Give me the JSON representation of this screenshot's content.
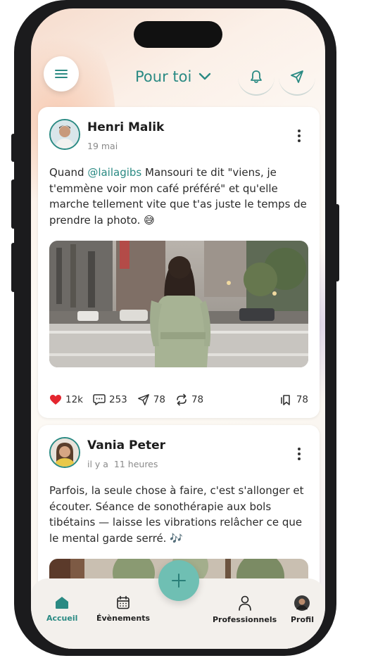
{
  "header": {
    "title": "Pour toi",
    "menu_icon": "hamburger-icon",
    "notif_icon": "bell-icon",
    "send_icon": "paper-plane-icon",
    "accent": "#2a8a83"
  },
  "posts": [
    {
      "author": "Henri Malik",
      "date": "19 mai",
      "text_before": "Quand ",
      "mention": "@lailagibs",
      "text_after": " Mansouri te dit \"viens, je t'emmène voir mon café préféré\" et qu'elle marche tellement vite que t'as juste le temps de prendre la photo. 😅",
      "likes": "12k",
      "comments": "253",
      "shares": "78",
      "reposts": "78",
      "saves": "78"
    },
    {
      "author": "Vania Peter",
      "date_prefix": "il y a",
      "date": "11 heures",
      "text": "Parfois, la seule chose à faire, c'est s'allonger et écouter. Séance de sonothérapie aux bols tibétains — laisse les vibrations relâcher ce que le mental garde serré. 🎶"
    }
  ],
  "nav": {
    "home": "Accueil",
    "events": "Évènements",
    "pros": "Professionnels",
    "profile": "Profil"
  }
}
